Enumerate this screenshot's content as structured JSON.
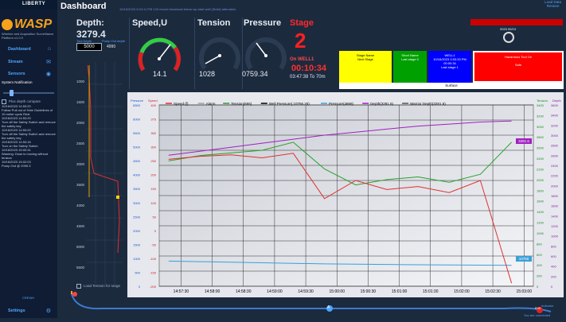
{
  "brand": {
    "liberty": "LIBERTY",
    "wasp": "WASP",
    "tagline": "Wireline and Acquisition Surveillance Platform v1.0.0"
  },
  "nav": [
    {
      "label": "Dashboard",
      "icon": "home-icon"
    },
    {
      "label": "Stream",
      "icon": "chat-icon"
    },
    {
      "label": "Sensors",
      "icon": "sensor-icon"
    }
  ],
  "sidebar": {
    "system_notification": "System Notification",
    "plus_depth_label": "Plus depth compare",
    "messages": "10/16/2023 14:53:20\nFollow Pull out of Hole Guidelines of 10 meter cycle Rest\n10/16/2023 14:53:20\nTurn off the Safety Switch and remove the safety key\n10/16/2023 14:53:20\nTurn off the Safety Switch and remove the safety key\n10/16/2023 14:53:16\nTurn on the Safety Switch\n10/16/2023 15:00:31\nWarning: Dose is moving without tension\n10/16/2023 15:02:03\nPump Out @ 2090.3",
    "crewh": "CREWH",
    "settings": "Settings"
  },
  "header": {
    "title": "Dashboard",
    "ticker": "10/16/2023 3:04:11 PM 120 record download below wp start well (3hAd) attendees",
    "load_data": "Load Data",
    "restore": "Restore"
  },
  "metrics": {
    "depth_title": "Depth:",
    "depth_value": "3279.4",
    "tool_depth_label": "Tool Depth",
    "pump_out_label": "Pump Out depth",
    "depth_input": "5000",
    "pump_out_value": "4990",
    "speed_title": "Speed,U",
    "speed_value": "14.1",
    "tension_title": "Tension",
    "tension_value": "1028",
    "pressure_title": "Pressure",
    "pressure_value": "0759.34",
    "stage_label": "Stage",
    "stage_number": "2",
    "on_well": "On WELL1",
    "timer": "00:10:34",
    "eta": "03:47:38 To 70m"
  },
  "stage_boxes": [
    {
      "text": "Stage Name\nNext Stage",
      "color": "#ffff00"
    },
    {
      "text": "Short Name\nLast stage 0",
      "color": "#00a000"
    },
    {
      "text": "WELL1\n10/16/2023 2:53:33 PM\n00:00:34\nLast stage 1",
      "color": "#0000ff"
    },
    {
      "text": "Hazardous Tool On\n\nSafe",
      "color": "#ff0000"
    }
  ],
  "surface_label": "Surface",
  "well": {
    "date": "2023 09/13",
    "hole": "25"
  },
  "chart_buttons": [
    "Save",
    "Zoom In",
    "Zoom Out",
    "Pointer",
    "Reset"
  ],
  "chart_combo": "500",
  "ruler": [
    "1000",
    "1500",
    "2000",
    "2500",
    "3000",
    "3500",
    "4000",
    "4500",
    "5000",
    "5500"
  ],
  "load_tension_label": "Load Tension for range",
  "timeline": {
    "marker": "A",
    "end_marker": "END",
    "footer_left": "Indicator",
    "footer_right": "You are connected",
    "date": "15:03:27.00"
  },
  "chart_data": {
    "type": "line",
    "x_ticks": [
      "14:57:30",
      "14:58:00",
      "14:58:30",
      "14:59:00",
      "14:59:30",
      "15:00:00",
      "15:00:30",
      "15:01:00",
      "15:01:30",
      "15:02:00",
      "15:02:30",
      "15:03:00"
    ],
    "legend": [
      "Speed (f)",
      "Alarm",
      "Tension(655)",
      "Well Pressure(,10756.26)",
      "Pressure(4868)",
      "Depth(3281.6)",
      "Warrior Depth(3281.6)"
    ],
    "left_axis_label": "Pressure",
    "left_axis2_label": "Speed",
    "right_axis_label": "Tension",
    "right_axis2_label": "Depth",
    "left_ticks": [
      "6500",
      "6000",
      "5500",
      "5000",
      "4500",
      "4000",
      "3500",
      "3000",
      "2500",
      "2000",
      "1500",
      "1000",
      "500",
      "0"
    ],
    "speed_ticks": [
      "400",
      "375",
      "350",
      "300",
      "250",
      "200",
      "150",
      "100",
      "50",
      "0",
      "-50",
      "-100",
      "-150",
      "-200"
    ],
    "tension_ticks": [
      "3400",
      "3200",
      "3000",
      "2800",
      "2600",
      "2400",
      "2200",
      "2000",
      "1800",
      "1600",
      "1400",
      "1200",
      "1000",
      "800",
      "600",
      "400",
      "200",
      "0"
    ],
    "depth_ticks": [
      "3600",
      "3400",
      "3200",
      "3000",
      "2800",
      "2600",
      "2400",
      "2200",
      "2000",
      "1800",
      "1600",
      "1400",
      "1200",
      "1000",
      "800",
      "600",
      "400",
      "200",
      "0"
    ],
    "depth_label_value": "3281.6",
    "pressure_label_value": "10756",
    "series": [
      {
        "name": "Depth",
        "color": "#a020c0",
        "values": [
          2600,
          2680,
          2760,
          2840,
          2920,
          3000,
          3060,
          3120,
          3180,
          3220,
          3260,
          3281
        ]
      },
      {
        "name": "Pressure",
        "color": "#3aa0d8",
        "values": [
          900,
          880,
          860,
          840,
          820,
          800,
          790,
          780,
          770,
          760,
          755,
          750
        ]
      },
      {
        "name": "Tension",
        "color": "#2aa02a",
        "values": [
          2350,
          2450,
          2500,
          2550,
          2700,
          2200,
          1900,
          2000,
          2050,
          1950,
          2100,
          2700
        ]
      },
      {
        "name": "Speed",
        "color": "#e03030",
        "values": [
          220,
          230,
          235,
          225,
          240,
          90,
          150,
          120,
          130,
          110,
          150,
          -190
        ]
      }
    ]
  }
}
